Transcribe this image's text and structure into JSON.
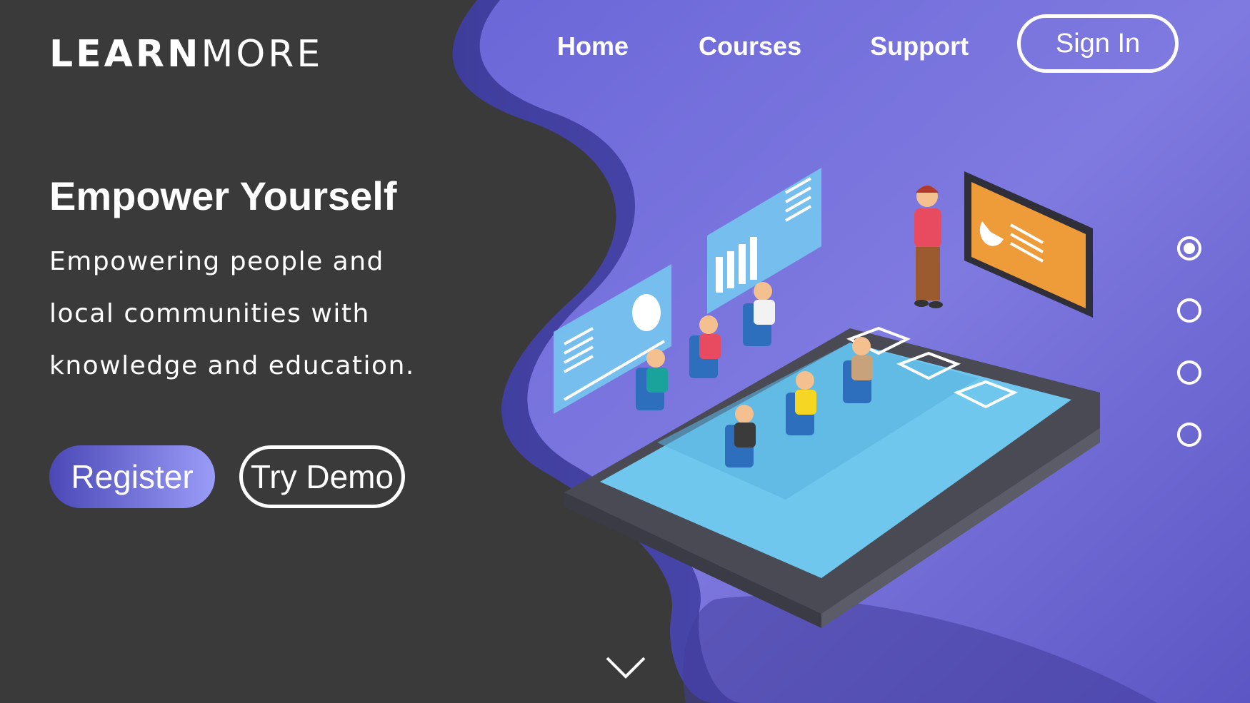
{
  "brand": {
    "part1": "LEARN",
    "part2": "MORE"
  },
  "nav": {
    "home": "Home",
    "courses": "Courses",
    "support": "Support",
    "signin": "Sign In"
  },
  "hero": {
    "title": "Empower Yourself",
    "text": "Empowering people and local communities with knowledge and education."
  },
  "buttons": {
    "register": "Register",
    "demo": "Try Demo"
  },
  "slider": {
    "count": 4,
    "active_index": 0
  },
  "colors": {
    "background": "#3a3a3a",
    "purple_light": "#9a9cf8",
    "purple_dark": "#4b48b6",
    "screen_blue": "#6fc7ee",
    "panel_orange": "#ee9b3a"
  },
  "icons": {
    "scroll": "chevron-down-icon"
  }
}
